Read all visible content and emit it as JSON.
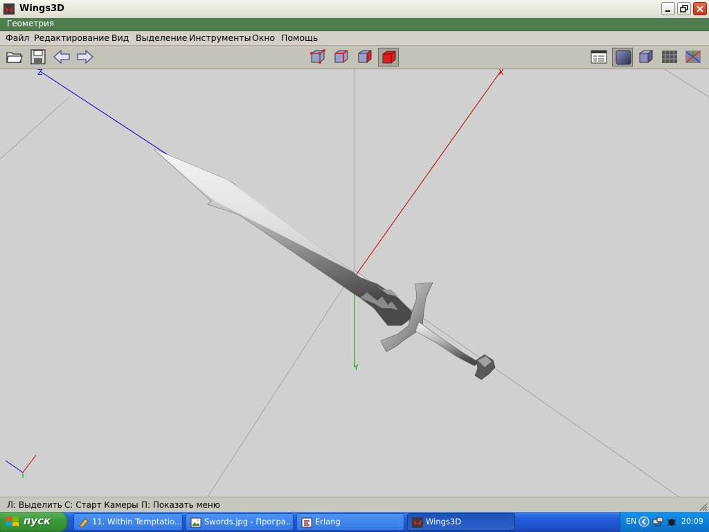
{
  "window": {
    "title": "Wings3D"
  },
  "geometry_bar": {
    "label": "Геометрия"
  },
  "menu": [
    {
      "label": "Файл"
    },
    {
      "label": "Редактирование"
    },
    {
      "label": "Вид"
    },
    {
      "label": "Выделение"
    },
    {
      "label": "Инструменты"
    },
    {
      "label": "Окно"
    },
    {
      "label": "Помощь"
    }
  ],
  "viewport": {
    "axis_labels": {
      "x": "X",
      "y": "Y",
      "z": "Z"
    },
    "colors": {
      "background": "#d0d0d0",
      "x_axis": "#c00000",
      "y_axis": "#00a000",
      "z_axis": "#0000c0",
      "grid": "#808080"
    }
  },
  "status": [
    {
      "label": "Л: Выделить"
    },
    {
      "label": "С: Старт Камеры"
    },
    {
      "label": "П: Показать меню"
    }
  ],
  "taskbar": {
    "start_label": "пуск",
    "tasks": [
      {
        "label": "11. Within Temptatio..."
      },
      {
        "label": "Swords.jpg - Програ..."
      },
      {
        "label": "Erlang"
      },
      {
        "label": "Wings3D"
      }
    ],
    "tray": {
      "lang": "EN",
      "time": "20:09"
    }
  }
}
